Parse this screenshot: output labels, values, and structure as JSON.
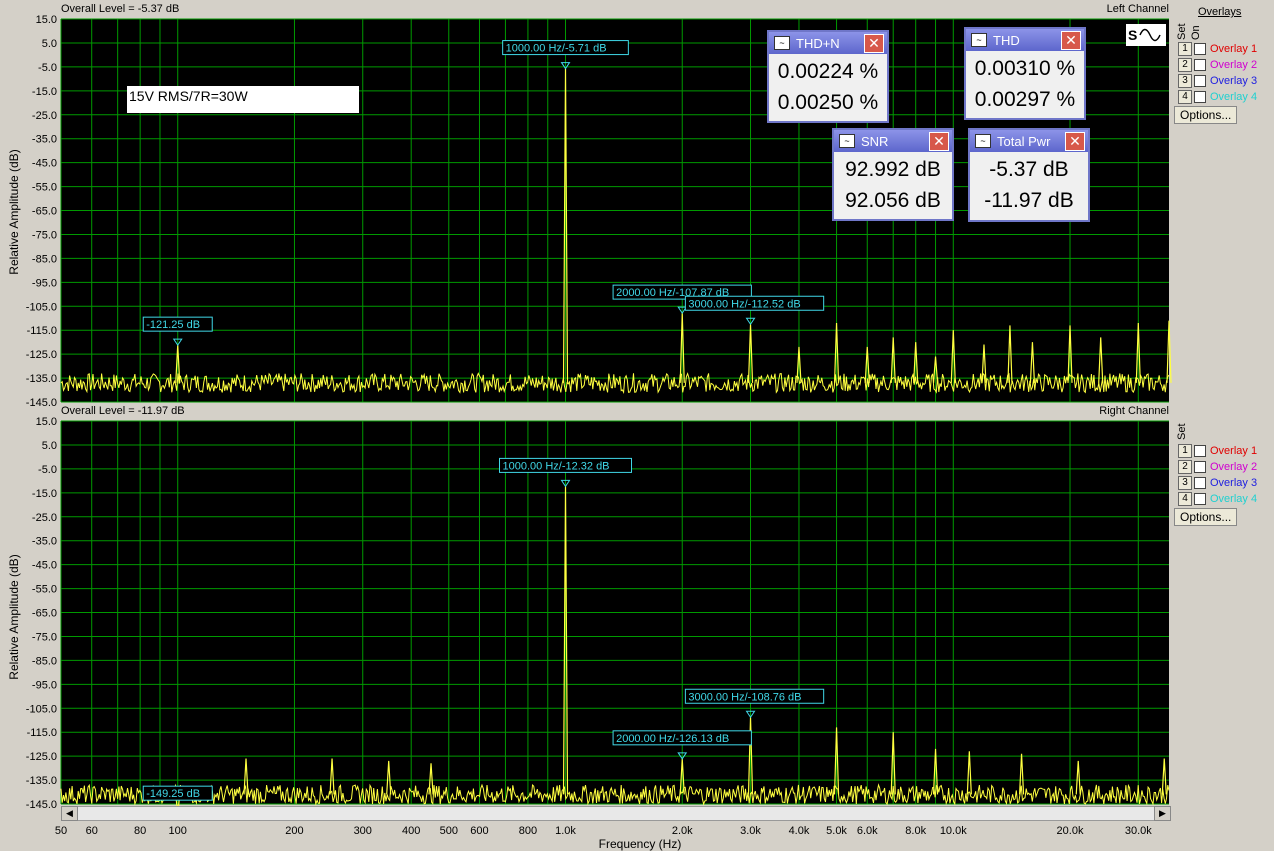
{
  "note_label": "15V RMS/7R=30W",
  "overlays_label": "Overlays",
  "set_label": "Set",
  "on_label": "On",
  "options_label": "Options...",
  "overlays": [
    {
      "num": "1",
      "label": "Overlay 1",
      "color": "#e00000"
    },
    {
      "num": "2",
      "label": "Overlay 2",
      "color": "#d000d0"
    },
    {
      "num": "3",
      "label": "Overlay 3",
      "color": "#2020e0"
    },
    {
      "num": "4",
      "label": "Overlay 4",
      "color": "#20d0d0"
    }
  ],
  "meters": [
    {
      "title": "THD+N",
      "v1": "0.00224 %",
      "v2": "0.00250 %"
    },
    {
      "title": "THD",
      "v1": "0.00310 %",
      "v2": "0.00297 %"
    },
    {
      "title": "SNR",
      "v1": "92.992 dB",
      "v2": "92.056 dB"
    },
    {
      "title": "Total Pwr",
      "v1": "-5.37 dB",
      "v2": "-11.97 dB"
    }
  ],
  "colors": {
    "plot_bg": "#000000",
    "grid": "#009a00",
    "trace": "#ffff40",
    "marker": "#40d8e8"
  },
  "chart_data": [
    {
      "type": "line",
      "panel_title": "Overall Level = -5.37 dB",
      "channel": "Left Channel",
      "ylabel": "Relative Amplitude (dB)",
      "xscale": "log",
      "xlim": [
        50,
        36000
      ],
      "ylim": [
        -145,
        15
      ],
      "yticks": [
        "15.0",
        "5.0",
        "-5.0",
        "-15.0",
        "-25.0",
        "-35.0",
        "-45.0",
        "-55.0",
        "-65.0",
        "-75.0",
        "-85.0",
        "-95.0",
        "-105.0",
        "-115.0",
        "-125.0",
        "-135.0",
        "-145.0"
      ],
      "noise_floor": -137,
      "spikes": [
        [
          100,
          -121.25
        ],
        [
          1000,
          -5.71
        ],
        [
          2000,
          -107.87
        ],
        [
          3000,
          -112.52
        ],
        [
          4000,
          -122
        ],
        [
          5000,
          -112
        ],
        [
          6000,
          -122
        ],
        [
          7000,
          -118
        ],
        [
          8000,
          -120
        ],
        [
          9000,
          -126
        ],
        [
          10000,
          -115
        ],
        [
          12000,
          -121
        ],
        [
          14000,
          -113
        ],
        [
          16000,
          -120
        ],
        [
          20000,
          -113
        ],
        [
          24000,
          -118
        ],
        [
          30000,
          -112
        ],
        [
          36000,
          -111
        ]
      ],
      "markers": [
        {
          "x": 100,
          "y": -121.25,
          "label": "-121.25 dB"
        },
        {
          "x": 1000,
          "y": -5.71,
          "label": "1000.00 Hz/-5.71 dB"
        },
        {
          "x": 2000,
          "y": -107.87,
          "label": "2000.00 Hz/-107.87 dB"
        },
        {
          "x": 3000,
          "y": -112.52,
          "label": "3000.00 Hz/-112.52 dB"
        }
      ]
    },
    {
      "type": "line",
      "panel_title": "Overall Level = -11.97 dB",
      "channel": "Right Channel",
      "ylabel": "Relative Amplitude (dB)",
      "xlabel": "Frequency (Hz)",
      "xscale": "log",
      "xlim": [
        50,
        36000
      ],
      "ylim": [
        -145,
        15
      ],
      "yticks": [
        "15.0",
        "5.0",
        "-5.0",
        "-15.0",
        "-25.0",
        "-35.0",
        "-45.0",
        "-55.0",
        "-65.0",
        "-75.0",
        "-85.0",
        "-95.0",
        "-105.0",
        "-115.0",
        "-125.0",
        "-135.0",
        "-145.0"
      ],
      "xticks": [
        "50",
        "60",
        "80",
        "100",
        "200",
        "300",
        "400",
        "500",
        "600",
        "800",
        "1.0k",
        "2.0k",
        "3.0k",
        "4.0k",
        "5.0k",
        "6.0k",
        "8.0k",
        "10.0k",
        "20.0k",
        "30.0k"
      ],
      "xtick_values": [
        50,
        60,
        80,
        100,
        200,
        300,
        400,
        500,
        600,
        800,
        1000,
        2000,
        3000,
        4000,
        5000,
        6000,
        8000,
        10000,
        20000,
        30000
      ],
      "noise_floor": -141,
      "spikes": [
        [
          100,
          -149.25
        ],
        [
          150,
          -126
        ],
        [
          250,
          -126
        ],
        [
          350,
          -127
        ],
        [
          450,
          -128
        ],
        [
          1000,
          -12.32
        ],
        [
          2000,
          -126.13
        ],
        [
          3000,
          -108.76
        ],
        [
          5000,
          -113
        ],
        [
          7000,
          -115
        ],
        [
          9000,
          -122
        ],
        [
          11000,
          -123
        ],
        [
          15000,
          -124
        ],
        [
          21000,
          -127
        ],
        [
          35000,
          -126
        ]
      ],
      "markers": [
        {
          "x": 100,
          "y": -149.25,
          "label": "-149.25 dB"
        },
        {
          "x": 1000,
          "y": -12.32,
          "label": "1000.00 Hz/-12.32 dB"
        },
        {
          "x": 2000,
          "y": -126.13,
          "label": "2000.00 Hz/-126.13 dB"
        },
        {
          "x": 3000,
          "y": -108.76,
          "label": "3000.00 Hz/-108.76 dB"
        }
      ]
    }
  ]
}
